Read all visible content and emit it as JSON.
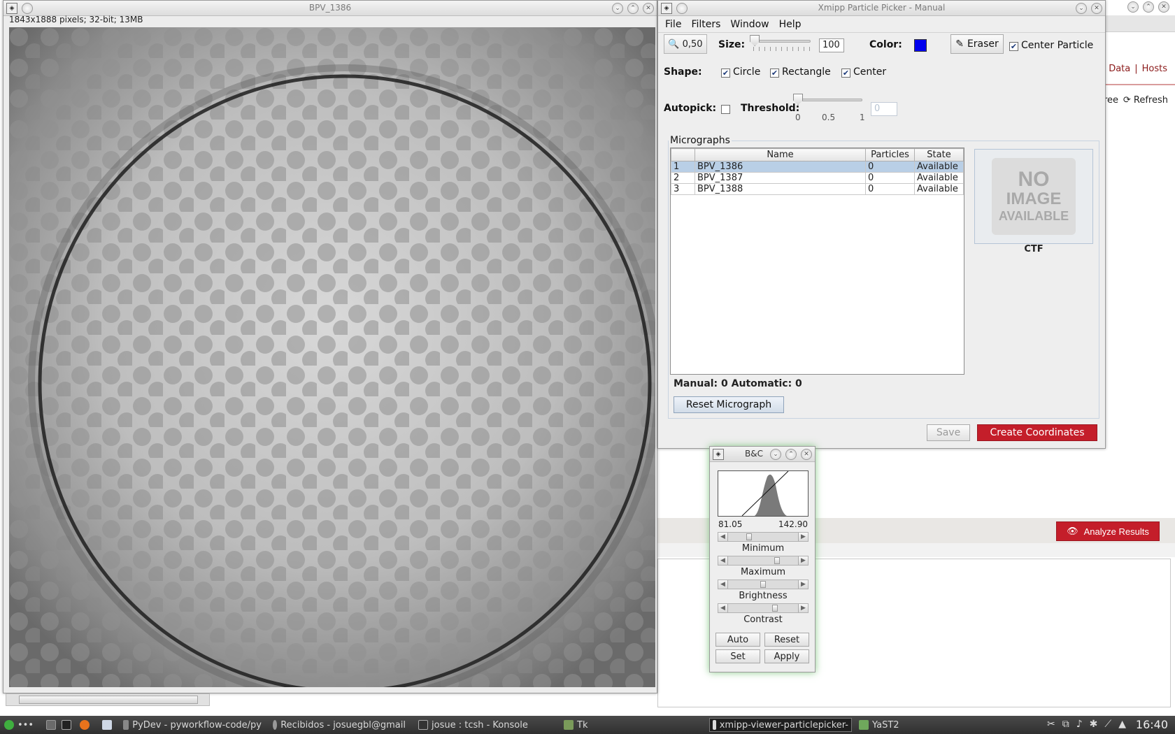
{
  "background_app": {
    "links": [
      "Data",
      "|",
      "Hosts"
    ],
    "tree_label": "ree",
    "refresh_label": "Refresh",
    "analyze_label": "Analyze Results"
  },
  "viewer": {
    "title": "BPV_1386",
    "info": "1843x1888 pixels; 32-bit; 13MB"
  },
  "picker": {
    "title": "Xmipp Particle Picker - Manual",
    "menu": [
      "File",
      "Filters",
      "Window",
      "Help"
    ],
    "zoom": "0,50",
    "size_label": "Size:",
    "size_value": "100",
    "size_slider_fraction": 0.05,
    "color_label": "Color:",
    "color_value": "#0000ee",
    "eraser_label": "Eraser",
    "center_particle_label": "Center Particle",
    "center_particle_checked": true,
    "shape_label": "Shape:",
    "shapes": [
      {
        "label": "Circle",
        "checked": true
      },
      {
        "label": "Rectangle",
        "checked": true
      },
      {
        "label": "Center",
        "checked": true
      }
    ],
    "autopick_label": "Autopick:",
    "autopick_checked": false,
    "threshold_label": "Threshold:",
    "threshold_value": "0",
    "threshold_ticks": [
      "0",
      "0.5",
      "1"
    ],
    "micrographs_label": "Micrographs",
    "columns": [
      "",
      "Name",
      "Particles",
      "State"
    ],
    "rows": [
      {
        "idx": "1",
        "name": "BPV_1386",
        "particles": "0",
        "state": "Available",
        "selected": true
      },
      {
        "idx": "2",
        "name": "BPV_1387",
        "particles": "0",
        "state": "Available",
        "selected": false
      },
      {
        "idx": "3",
        "name": "BPV_1388",
        "particles": "0",
        "state": "Available",
        "selected": false
      }
    ],
    "no_image_lines": [
      "NO",
      "IMAGE",
      "AVAILABLE"
    ],
    "ctf_label": "CTF",
    "counts": "Manual: 0 Automatic: 0",
    "reset_label": "Reset Micrograph",
    "save_label": "Save",
    "create_label": "Create Coordinates"
  },
  "bc": {
    "title": "B&C",
    "min_value": "81.05",
    "max_value": "142.90",
    "sliders": [
      {
        "label": "Minimum",
        "level": 0.28
      },
      {
        "label": "Maximum",
        "level": 0.72
      },
      {
        "label": "Brightness",
        "level": 0.5
      },
      {
        "label": "Contrast",
        "level": 0.68
      }
    ],
    "buttons": [
      "Auto",
      "Reset",
      "Set",
      "Apply"
    ]
  },
  "taskbar": {
    "tasks": [
      "PyDev - pyworkflow-code/py",
      "Recibidos - josuegbl@gmail",
      "josue : tcsh - Konsole",
      "Tk",
      "xmipp-viewer-particlepicker-",
      "YaST2"
    ],
    "clock": "16:40"
  }
}
